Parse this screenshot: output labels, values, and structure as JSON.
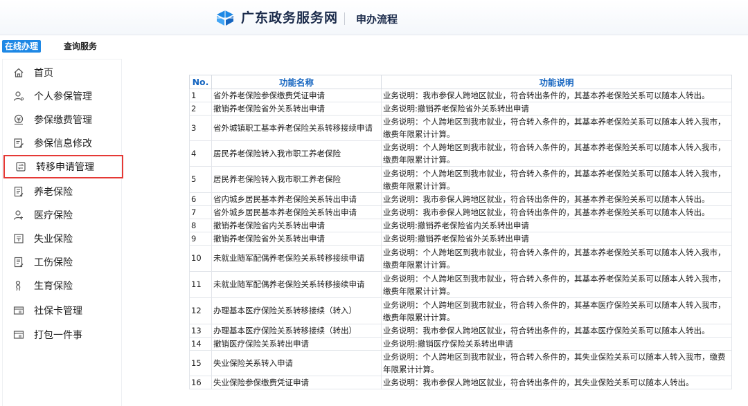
{
  "header": {
    "site_title": "广东政务服务网",
    "subtitle": "申办流程"
  },
  "colors": {
    "accent": "#1e88e5",
    "highlight": "#e53935",
    "header_text": "#1565c0"
  },
  "tabs": [
    {
      "label": "在线办理",
      "active": true
    },
    {
      "label": "查询服务",
      "active": false
    }
  ],
  "sidebar": {
    "items": [
      {
        "label": "首页",
        "icon": "home-icon"
      },
      {
        "label": "个人参保管理",
        "icon": "user-icon"
      },
      {
        "label": "参保缴费管理",
        "icon": "payment-icon"
      },
      {
        "label": "参保信息修改",
        "icon": "edit-icon"
      },
      {
        "label": "转移申请管理",
        "icon": "transfer-icon",
        "active": true
      },
      {
        "label": "养老保险",
        "icon": "document-icon"
      },
      {
        "label": "医疗保险",
        "icon": "medical-user-icon"
      },
      {
        "label": "失业保险",
        "icon": "unemployment-icon"
      },
      {
        "label": "工伤保险",
        "icon": "document-icon"
      },
      {
        "label": "生育保险",
        "icon": "maternity-icon"
      },
      {
        "label": "社保卡管理",
        "icon": "card-icon"
      },
      {
        "label": "打包一件事",
        "icon": "package-icon"
      }
    ]
  },
  "table": {
    "headers": {
      "no": "No.",
      "name": "功能名称",
      "desc": "功能说明"
    },
    "rows": [
      {
        "no": "1",
        "name": "省外养老保险参保缴费凭证申请",
        "desc": "业务说明：我市参保人跨地区就业，符合转出条件的，其基本养老保险关系可以随本人转出。"
      },
      {
        "no": "2",
        "name": "撤销养老保险省外关系转出申请",
        "desc": "业务说明:撤销养老保险省外关系转出申请"
      },
      {
        "no": "3",
        "name": "省外城镇职工基本养老保险关系转移接续申请",
        "desc": "业务说明：个人跨地区到我市就业，符合转入条件的，其基本养老保险关系可以随本人转入我市，缴费年限累计计算。"
      },
      {
        "no": "4",
        "name": "居民养老保险转入我市职工养老保险",
        "desc": "业务说明：个人跨地区到我市就业，符合转入条件的，其基本养老保险关系可以随本人转入我市，缴费年限累计计算。"
      },
      {
        "no": "5",
        "name": "居民养老保险转入我市职工养老保险",
        "desc": "业务说明：个人跨地区到我市就业，符合转入条件的，其基本养老保险关系可以随本人转入我市，缴费年限累计计算。"
      },
      {
        "no": "6",
        "name": "省内城乡居民基本养老保险关系转出申请",
        "desc": "业务说明：我市参保人跨地区就业，符合转出条件的，其基本养老保险关系可以随本人转出。"
      },
      {
        "no": "7",
        "name": "省外城乡居民基本养老保险关系转出申请",
        "desc": "业务说明：我市参保人跨地区就业，符合转出条件的，其基本养老保险关系可以随本人转出。"
      },
      {
        "no": "8",
        "name": "撤销养老保险省内关系转出申请",
        "desc": "业务说明:撤销养老保险省内关系转出申请"
      },
      {
        "no": "9",
        "name": "撤销养老保险省外关系转出申请",
        "desc": "业务说明:撤销养老保险省外关系转出申请"
      },
      {
        "no": "10",
        "name": "未就业随军配偶养老保险关系转移接续申请",
        "desc": "业务说明：个人跨地区到我市就业，符合转入条件的，其基本养老保险关系可以随本人转入我市，缴费年限累计计算。"
      },
      {
        "no": "11",
        "name": "未就业随军配偶养老保险关系转移接续申请",
        "desc": "业务说明：个人跨地区到我市就业，符合转入条件的，其基本养老保险关系可以随本人转入我市，缴费年限累计计算。"
      },
      {
        "no": "12",
        "name": "办理基本医疗保险关系转移接续（转入）",
        "desc": "业务说明：个人跨地区到我市就业，符合转入条件的，其基本医疗保险关系可以随本人转入我市，缴费年限累计计算。"
      },
      {
        "no": "13",
        "name": "办理基本医疗保险关系转移接续（转出）",
        "desc": "业务说明：我市参保人跨地区就业，符合转出条件的，其基本医疗保险关系可以随本人转出。"
      },
      {
        "no": "14",
        "name": "撤销医疗保险关系转出申请",
        "desc": "业务说明:撤销医疗保险关系转出申请"
      },
      {
        "no": "15",
        "name": "失业保险关系转入申请",
        "desc": "业务说明：个人跨地区到我市就业，符合转入条件的，其失业保险关系可以随本人转入我市，缴费年限累计计算。"
      },
      {
        "no": "16",
        "name": "失业保险参保缴费凭证申请",
        "desc": "业务说明：我市参保人跨地区就业，符合转出条件的，其失业保险关系可以随本人转出。"
      }
    ]
  }
}
